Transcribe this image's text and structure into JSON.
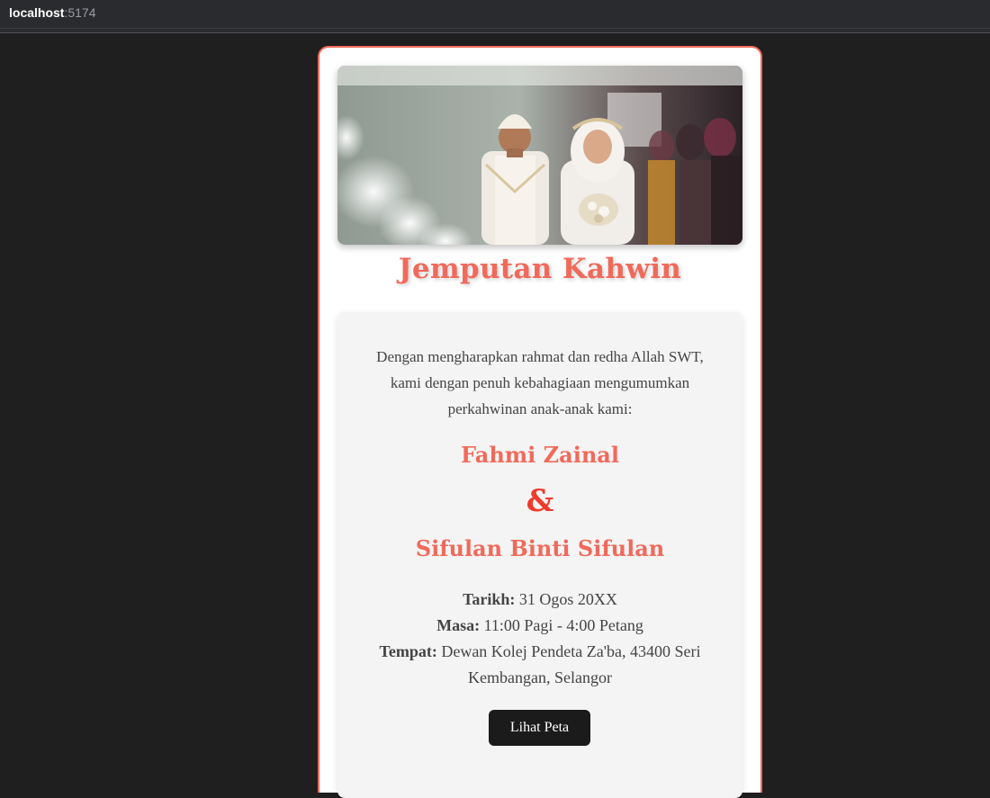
{
  "browser": {
    "host": "localhost",
    "port": ":5174"
  },
  "invitation": {
    "title": "Jemputan Kahwin",
    "photo_alt": "Wedding couple photo",
    "intro": "Dengan mengharapkan rahmat dan redha Allah SWT, kami dengan penuh kebahagiaan mengumumkan perkahwinan anak-anak kami:",
    "groom": "Fahmi Zainal",
    "ampersand": "&",
    "bride": "Sifulan Binti Sifulan",
    "details": {
      "date_label": "Tarikh:",
      "date_value": " 31 Ogos 20XX",
      "time_label": "Masa:",
      "time_value": " 11:00 Pagi - 4:00 Petang",
      "venue_label": "Tempat:",
      "venue_value": " Dewan Kolej Pendeta Za'ba, 43400 Seri Kembangan, Selangor"
    },
    "map_button": "Lihat Peta"
  },
  "colors": {
    "accent": "#f06a5b",
    "ampersand": "#ee3b2d",
    "button_bg": "#1b1b1b",
    "panel_bg": "#f4f4f4",
    "page_bg": "#1f1f1f"
  }
}
